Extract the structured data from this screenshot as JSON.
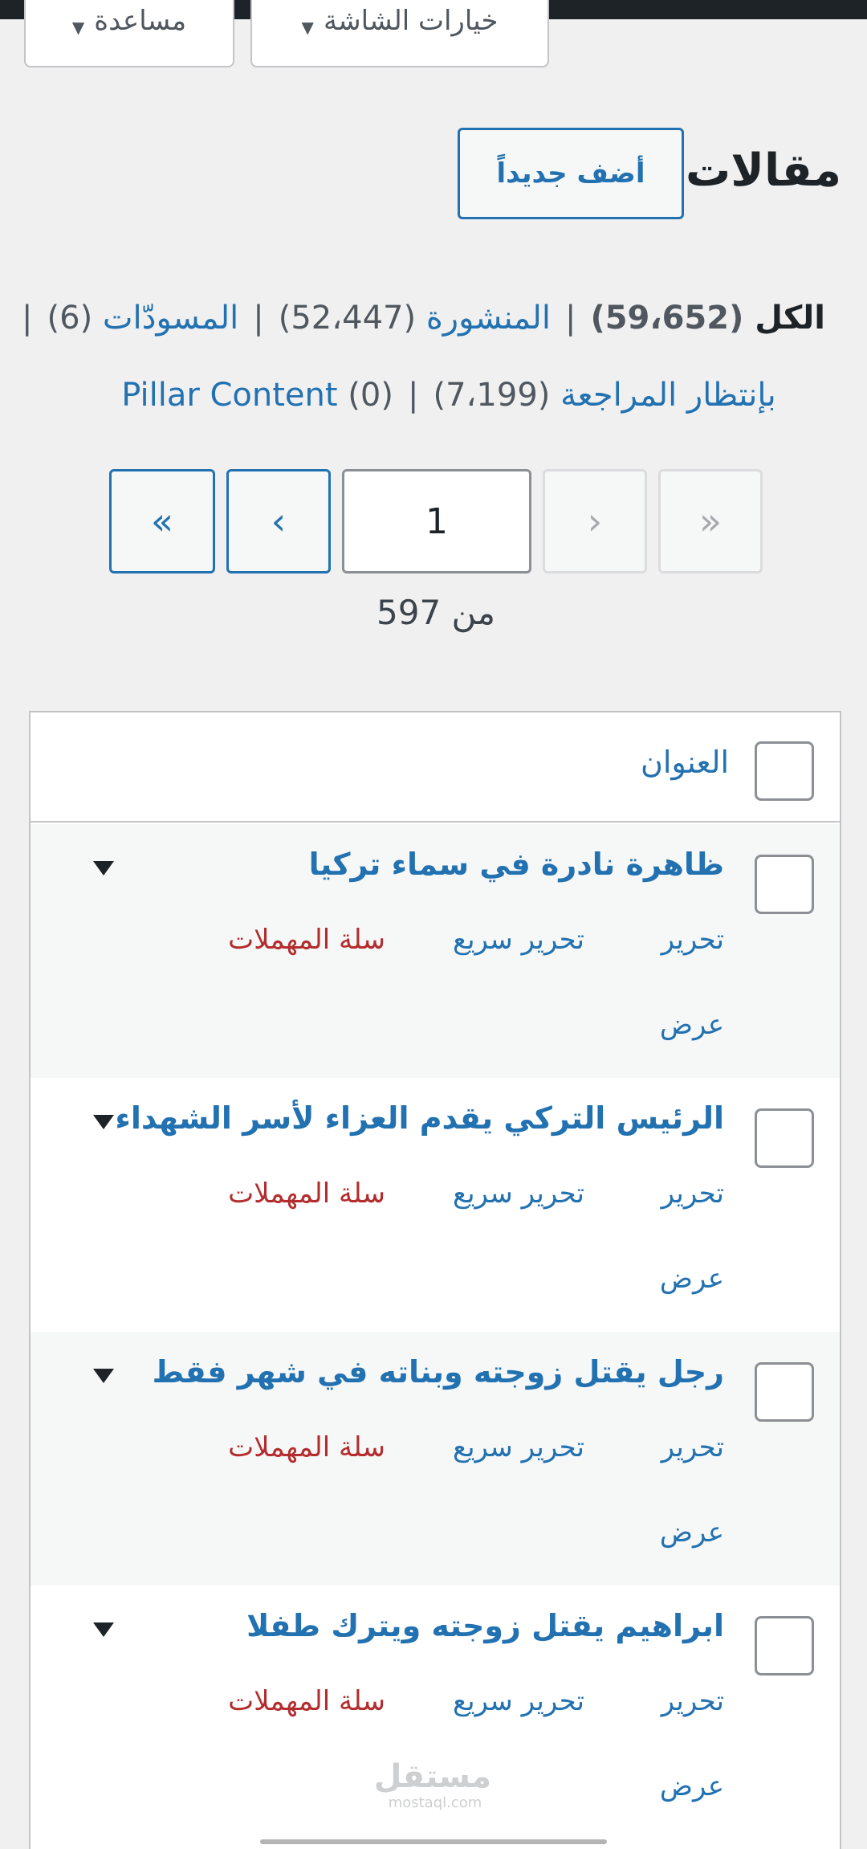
{
  "screen_tabs": {
    "screen_options": "خيارات الشاشة",
    "help": "مساعدة"
  },
  "header": {
    "title": "مقالات",
    "add_new": "أضف جديداً"
  },
  "filters": {
    "all": {
      "label": "الكل",
      "count": "(59،652)"
    },
    "published": {
      "label": "المنشورة",
      "count": "(52،447)"
    },
    "drafts": {
      "label": "المسودّات",
      "count": "(6)"
    },
    "pending": {
      "label": "بإنتظار المراجعة",
      "count": "(7،199)"
    },
    "pillar": {
      "label": "Pillar Content",
      "count": "(0)"
    },
    "separator": "|"
  },
  "pagination": {
    "first": "«",
    "prev": "‹",
    "current_page": "1",
    "next": "›",
    "last": "»",
    "of_total": "من 597"
  },
  "table": {
    "column_title": "العنوان",
    "row_actions": {
      "edit": "تحرير",
      "quick_edit": "تحرير سريع",
      "trash": "سلة المهملات",
      "view": "عرض"
    },
    "rows": [
      {
        "title": "ظاهرة نادرة في سماء تركيا"
      },
      {
        "title": "الرئيس التركي يقدم العزاء لأسر الشهداء"
      },
      {
        "title": "رجل يقتل زوجته وبناته في شهر فقط"
      },
      {
        "title": "ابراهيم يقتل زوجته ويترك طفلا"
      }
    ]
  },
  "watermark": {
    "arabic": "مستقل",
    "latin": "mostaql.com"
  },
  "colors": {
    "link": "#2271b1",
    "trash": "#b32d2e",
    "background": "#f0f0f1"
  }
}
